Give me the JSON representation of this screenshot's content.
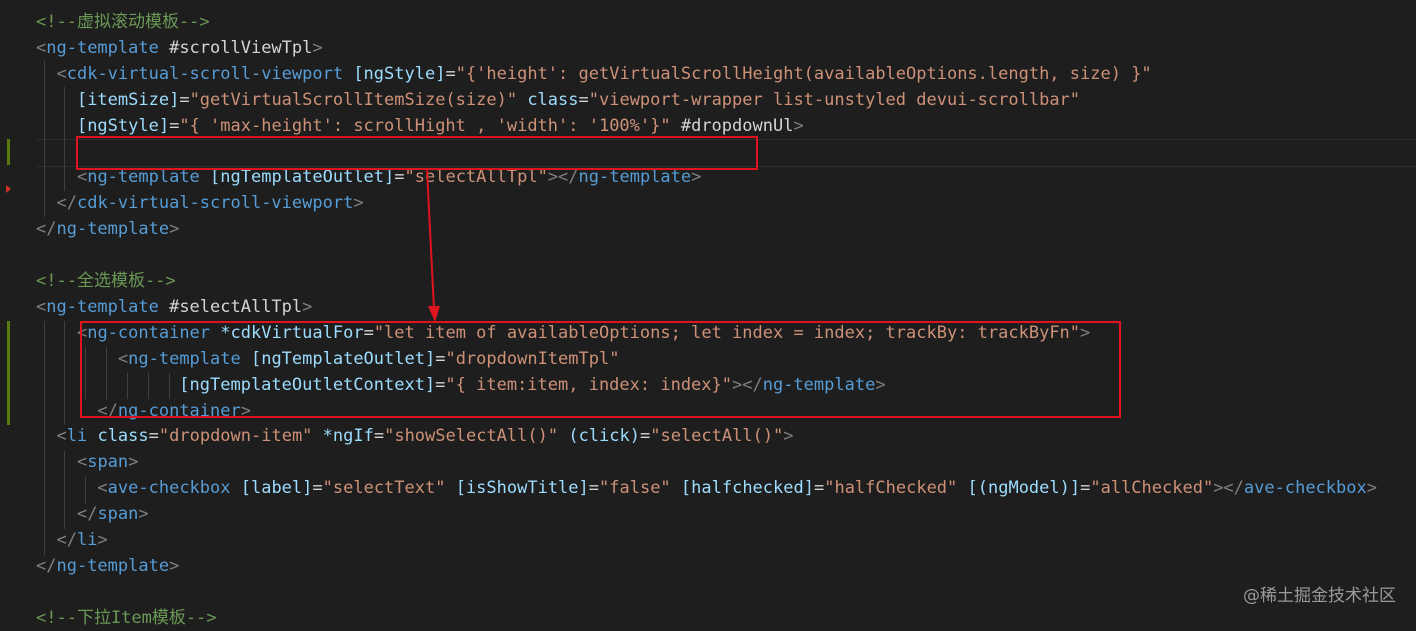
{
  "lines": [
    [
      {
        "t": "<!--虚拟滚动模板-->",
        "c": "comment"
      }
    ],
    [
      {
        "t": "<",
        "c": "punc"
      },
      {
        "t": "ng-template",
        "c": "tag"
      },
      {
        "t": " #scrollViewTpl",
        "c": "ref"
      },
      {
        "t": ">",
        "c": "punc"
      }
    ],
    [
      {
        "t": "  "
      },
      {
        "t": "<",
        "c": "punc"
      },
      {
        "t": "cdk-virtual-scroll-viewport",
        "c": "tag"
      },
      {
        "t": " [ngStyle]",
        "c": "attr"
      },
      {
        "t": "=",
        "c": "eq"
      },
      {
        "t": "\"{'height': getVirtualScrollHeight(availableOptions.length, size) }\"",
        "c": "str"
      }
    ],
    [
      {
        "t": "    "
      },
      {
        "t": "[itemSize]",
        "c": "attr"
      },
      {
        "t": "=",
        "c": "eq"
      },
      {
        "t": "\"getVirtualScrollItemSize(size)\"",
        "c": "str"
      },
      {
        "t": " class",
        "c": "attr"
      },
      {
        "t": "=",
        "c": "eq"
      },
      {
        "t": "\"viewport-wrapper list-unstyled devui-scrollbar\"",
        "c": "str"
      }
    ],
    [
      {
        "t": "    "
      },
      {
        "t": "[ngStyle]",
        "c": "attr"
      },
      {
        "t": "=",
        "c": "eq"
      },
      {
        "t": "\"{ 'max-height': scrollHight , 'width': '100%'}\"",
        "c": "str"
      },
      {
        "t": " #dropdownUl",
        "c": "ref"
      },
      {
        "t": ">",
        "c": "punc"
      }
    ],
    [
      {
        "t": ""
      }
    ],
    [
      {
        "t": "    "
      },
      {
        "t": "<",
        "c": "punc"
      },
      {
        "t": "ng-template",
        "c": "tag"
      },
      {
        "t": " [ngTemplateOutlet]",
        "c": "attr"
      },
      {
        "t": "=",
        "c": "eq"
      },
      {
        "t": "\"selectAllTpl\"",
        "c": "str"
      },
      {
        "t": "></",
        "c": "punc"
      },
      {
        "t": "ng-template",
        "c": "tag"
      },
      {
        "t": ">",
        "c": "punc"
      }
    ],
    [
      {
        "t": "  "
      },
      {
        "t": "</",
        "c": "punc"
      },
      {
        "t": "cdk-virtual-scroll-viewport",
        "c": "tag"
      },
      {
        "t": ">",
        "c": "punc"
      }
    ],
    [
      {
        "t": "</",
        "c": "punc"
      },
      {
        "t": "ng-template",
        "c": "tag"
      },
      {
        "t": ">",
        "c": "punc"
      }
    ],
    [
      {
        "t": ""
      }
    ],
    [
      {
        "t": "<!--全选模板-->",
        "c": "comment"
      }
    ],
    [
      {
        "t": "<",
        "c": "punc"
      },
      {
        "t": "ng-template",
        "c": "tag"
      },
      {
        "t": " #selectAllTpl",
        "c": "ref"
      },
      {
        "t": ">",
        "c": "punc"
      }
    ],
    [
      {
        "t": "    "
      },
      {
        "t": "<",
        "c": "punc"
      },
      {
        "t": "ng-container",
        "c": "tag"
      },
      {
        "t": " *cdkVirtualFor",
        "c": "attr"
      },
      {
        "t": "=",
        "c": "eq"
      },
      {
        "t": "\"let item of availableOptions; let index = index; trackBy: trackByFn\"",
        "c": "str"
      },
      {
        "t": ">",
        "c": "punc"
      }
    ],
    [
      {
        "t": "        "
      },
      {
        "t": "<",
        "c": "punc"
      },
      {
        "t": "ng-template",
        "c": "tag"
      },
      {
        "t": " [ngTemplateOutlet]",
        "c": "attr"
      },
      {
        "t": "=",
        "c": "eq"
      },
      {
        "t": "\"dropdownItemTpl\"",
        "c": "str"
      }
    ],
    [
      {
        "t": "              "
      },
      {
        "t": "[ngTemplateOutletContext]",
        "c": "attr"
      },
      {
        "t": "=",
        "c": "eq"
      },
      {
        "t": "\"{ item:item, index: index}\"",
        "c": "str"
      },
      {
        "t": "></",
        "c": "punc"
      },
      {
        "t": "ng-template",
        "c": "tag"
      },
      {
        "t": ">",
        "c": "punc"
      }
    ],
    [
      {
        "t": "      "
      },
      {
        "t": "</",
        "c": "punc"
      },
      {
        "t": "ng-container",
        "c": "tag"
      },
      {
        "t": ">",
        "c": "punc"
      }
    ],
    [
      {
        "t": "  "
      },
      {
        "t": "<",
        "c": "punc"
      },
      {
        "t": "li",
        "c": "tag"
      },
      {
        "t": " class",
        "c": "attr"
      },
      {
        "t": "=",
        "c": "eq"
      },
      {
        "t": "\"dropdown-item\"",
        "c": "str"
      },
      {
        "t": " *ngIf",
        "c": "attr"
      },
      {
        "t": "=",
        "c": "eq"
      },
      {
        "t": "\"showSelectAll()\"",
        "c": "str"
      },
      {
        "t": " (click)",
        "c": "attr"
      },
      {
        "t": "=",
        "c": "eq"
      },
      {
        "t": "\"selectAll()\"",
        "c": "str"
      },
      {
        "t": ">",
        "c": "punc"
      }
    ],
    [
      {
        "t": "    "
      },
      {
        "t": "<",
        "c": "punc"
      },
      {
        "t": "span",
        "c": "tag"
      },
      {
        "t": ">",
        "c": "punc"
      }
    ],
    [
      {
        "t": "      "
      },
      {
        "t": "<",
        "c": "punc"
      },
      {
        "t": "ave-checkbox",
        "c": "tag"
      },
      {
        "t": " [label]",
        "c": "attr"
      },
      {
        "t": "=",
        "c": "eq"
      },
      {
        "t": "\"selectText\"",
        "c": "str"
      },
      {
        "t": " [isShowTitle]",
        "c": "attr"
      },
      {
        "t": "=",
        "c": "eq"
      },
      {
        "t": "\"false\"",
        "c": "str"
      },
      {
        "t": " [halfchecked]",
        "c": "attr"
      },
      {
        "t": "=",
        "c": "eq"
      },
      {
        "t": "\"halfChecked\"",
        "c": "str"
      },
      {
        "t": " [(ngModel)]",
        "c": "attr"
      },
      {
        "t": "=",
        "c": "eq"
      },
      {
        "t": "\"allChecked\"",
        "c": "str"
      },
      {
        "t": "></",
        "c": "punc"
      },
      {
        "t": "ave-checkbox",
        "c": "tag"
      },
      {
        "t": ">",
        "c": "punc"
      }
    ],
    [
      {
        "t": "    "
      },
      {
        "t": "</",
        "c": "punc"
      },
      {
        "t": "span",
        "c": "tag"
      },
      {
        "t": ">",
        "c": "punc"
      }
    ],
    [
      {
        "t": "  "
      },
      {
        "t": "</",
        "c": "punc"
      },
      {
        "t": "li",
        "c": "tag"
      },
      {
        "t": ">",
        "c": "punc"
      }
    ],
    [
      {
        "t": "</",
        "c": "punc"
      },
      {
        "t": "ng-template",
        "c": "tag"
      },
      {
        "t": ">",
        "c": "punc"
      }
    ],
    [
      {
        "t": ""
      }
    ],
    [
      {
        "t": "<!--下拉Item模板-->",
        "c": "comment"
      }
    ]
  ],
  "watermark": "@稀土掘金技术社区",
  "colors": {
    "background": "#1e1e1e",
    "tag": "#569cd6",
    "attribute": "#9cdcfe",
    "string": "#ce9178",
    "comment": "#6a9955",
    "annotation": "#e0141e"
  }
}
